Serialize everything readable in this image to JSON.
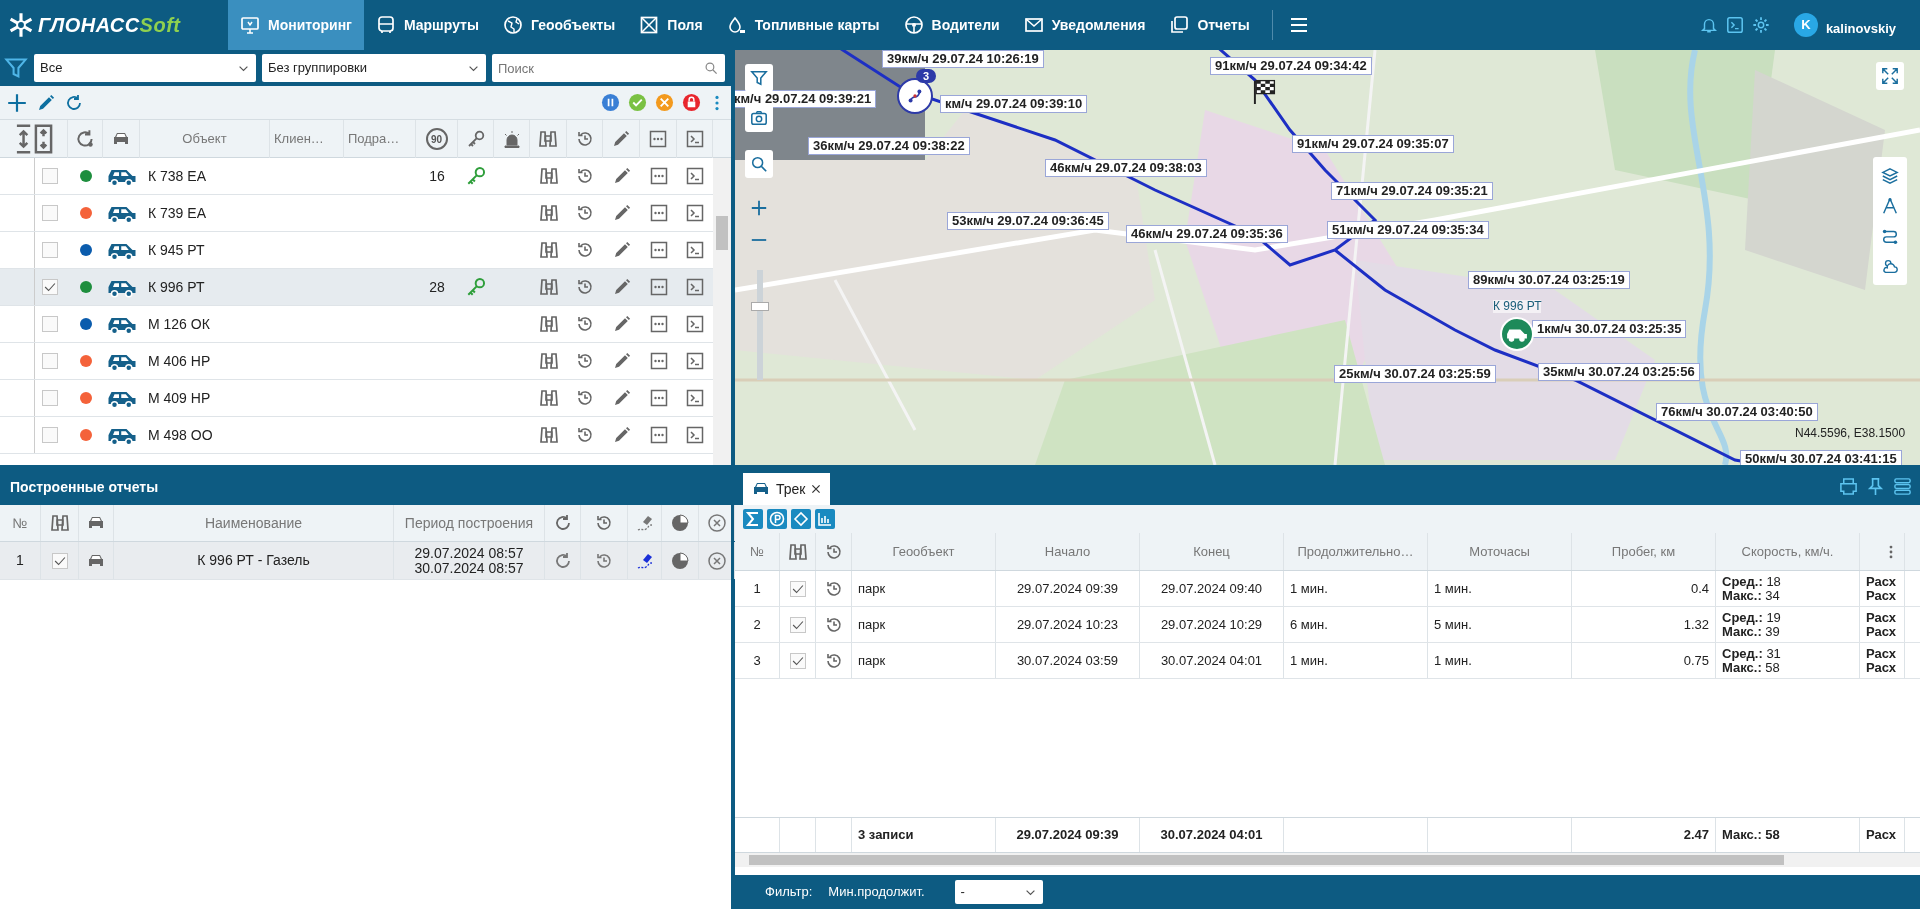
{
  "header": {
    "logo": {
      "main": "ГЛОНАСС",
      "accent": "Soft"
    },
    "nav": [
      {
        "label": "Мониторинг",
        "selected": true
      },
      {
        "label": "Маршруты",
        "selected": false
      },
      {
        "label": "Геообъекты",
        "selected": false
      },
      {
        "label": "Поля",
        "selected": false
      },
      {
        "label": "Топливные карты",
        "selected": false
      },
      {
        "label": "Водители",
        "selected": false
      },
      {
        "label": "Уведомления",
        "selected": false
      },
      {
        "label": "Отчеты",
        "selected": false
      }
    ],
    "user": {
      "initial": "K",
      "name": "kalinovskiy"
    }
  },
  "objects": {
    "filters": [
      {
        "value": "Все"
      },
      {
        "value": "Без группировки"
      }
    ],
    "search": {
      "placeholder": "Поиск"
    },
    "columns": [
      "Объект",
      "Клиен…",
      "Подра…"
    ],
    "speed_column": "90",
    "rows": [
      {
        "name": "К 738 ЕА",
        "color": "#1e8e3e",
        "checked": false,
        "selected": false,
        "speed": "16",
        "key": true
      },
      {
        "name": "К 739 ЕА",
        "color": "#f4623a",
        "checked": false,
        "selected": false,
        "key": false
      },
      {
        "name": "К 945 РТ",
        "color": "#0b5cad",
        "checked": false,
        "selected": false,
        "key": false
      },
      {
        "name": "К 996 РТ",
        "color": "#1e8e3e",
        "checked": true,
        "selected": true,
        "speed": "28",
        "key": true
      },
      {
        "name": "М 126 ОК",
        "color": "#0b5cad",
        "checked": false,
        "selected": false,
        "key": false
      },
      {
        "name": "М 406 НР",
        "color": "#f4623a",
        "checked": false,
        "selected": false,
        "key": false
      },
      {
        "name": "М 409 НР",
        "color": "#f4623a",
        "checked": false,
        "selected": false,
        "key": false
      },
      {
        "name": "М 498 ОО",
        "color": "#f4623a",
        "checked": false,
        "selected": false,
        "key": false
      }
    ]
  },
  "reports": {
    "title": "Построенные отчеты",
    "columns": [
      "№",
      "Наименование",
      "Период построения"
    ],
    "rows": [
      {
        "number": "1",
        "checked": true,
        "selected": true,
        "on_map": true,
        "name": "К 996 РТ - Газель",
        "period_from": "29.07.2024 08:57",
        "period_to": "30.07.2024 08:57"
      }
    ]
  },
  "map": {
    "zoom_slider": {
      "level": 0.68
    },
    "cluster_count": "3",
    "vehicle_label": "К 996 РТ",
    "coordinates": "N44.5596, E38.1500",
    "labels": [
      "39км/ч 29.07.24 10:26:19",
      "91км/ч 29.07.24 09:34:42",
      "км/ч 29.07.24 09:39:21",
      "км/ч 29.07.24 09:39:10",
      "36км/ч 29.07.24 09:38:22",
      "91км/ч 29.07.24 09:35:07",
      "46км/ч 29.07.24 09:38:03",
      "71км/ч 29.07.24 09:35:21",
      "53км/ч 29.07.24 09:36:45",
      "46км/ч 29.07.24 09:35:36",
      "51км/ч 29.07.24 09:35:34",
      "89км/ч 30.07.24 03:25:19",
      "1км/ч 30.07.24 03:25:35",
      "25км/ч 30.07.24 03:25:59",
      "35км/ч 30.07.24 03:25:56",
      "76км/ч 30.07.24 03:40:50",
      "50км/ч 30.07.24 03:41:15"
    ]
  },
  "track": {
    "tab": {
      "label": "Трек",
      "selected": true
    },
    "columns": [
      "№",
      "Геообъект",
      "Начало",
      "Конец",
      "Продолжительно…",
      "Моточасы",
      "Пробег, км",
      "Скорость, км/ч."
    ],
    "rows": [
      {
        "number": "1",
        "checked": true,
        "geoobject": "парк",
        "start": "29.07.2024 09:39",
        "end": "29.07.2024 09:40",
        "duration": "1 мин.",
        "engine_hours": "1 мин.",
        "mileage": "0.4",
        "speed": [
          "**Сред.:** 18",
          "**Макс.:** 34"
        ],
        "column_10": [
          "Расх",
          "Расх"
        ]
      },
      {
        "number": "2",
        "checked": true,
        "geoobject": "парк",
        "start": "29.07.2024 10:23",
        "end": "29.07.2024 10:29",
        "duration": "6 мин.",
        "engine_hours": "5 мин.",
        "mileage": "1.32",
        "speed": [
          "**Сред.:** 19",
          "**Макс.:** 39"
        ],
        "column_10": [
          "Расх",
          "Расх"
        ]
      },
      {
        "number": "3",
        "checked": true,
        "geoobject": "парк",
        "start": "30.07.2024 03:59",
        "end": "30.07.2024 04:01",
        "duration": "1 мин.",
        "engine_hours": "1 мин.",
        "mileage": "0.75",
        "speed": [
          "**Сред.:** 31",
          "**Макс.:** 58"
        ],
        "column_10": [
          "Расх",
          "Расх"
        ]
      }
    ],
    "totals": {
      "count": "3 записи",
      "start": "29.07.2024 09:39",
      "end": "30.07.2024 04:01",
      "mileage": "2.47",
      "speed": "Макс.: 58",
      "column_10": "Расх"
    },
    "filter": {
      "label": "Фильтр:",
      "min_duration_label": "Мин.продолжит.",
      "min_duration": "-"
    }
  }
}
